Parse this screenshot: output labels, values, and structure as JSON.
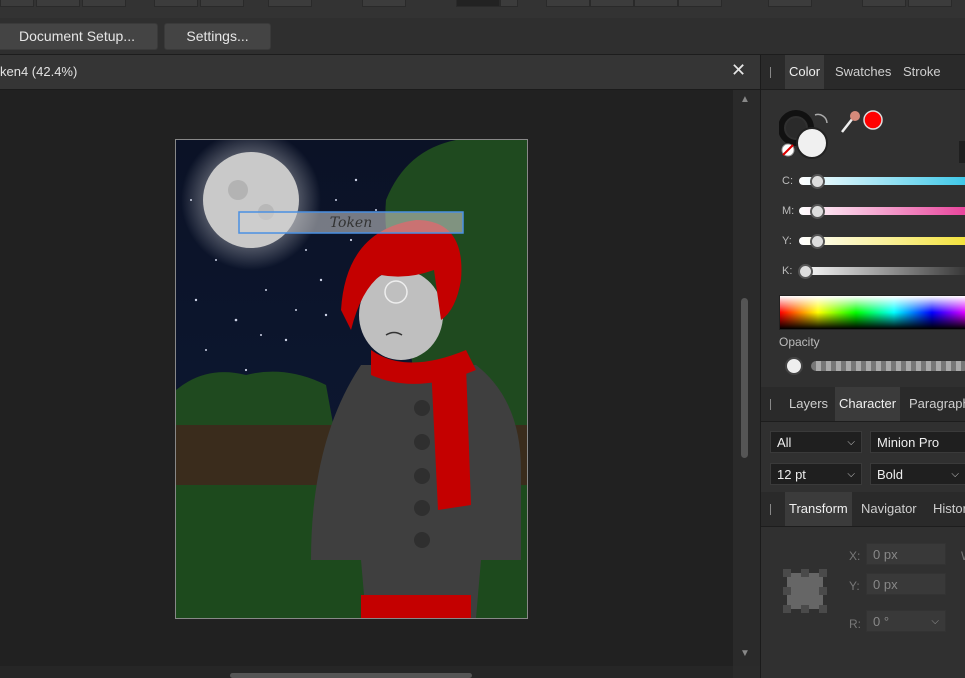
{
  "toolbar": {
    "document_setup_label": "Document Setup...",
    "settings_label": "Settings..."
  },
  "document": {
    "tab_title": "ken4 (42.4%)",
    "text_frame_content": "Token"
  },
  "color_panel": {
    "tabs": [
      "Color",
      "Swatches",
      "Stroke"
    ],
    "active_tab": "Color",
    "sliders": [
      {
        "label": "C:",
        "value": 0
      },
      {
        "label": "M:",
        "value": 0
      },
      {
        "label": "Y:",
        "value": 0
      },
      {
        "label": "K:",
        "value": 0
      }
    ],
    "opacity_label": "Opacity",
    "fill_color": "#ffffff",
    "picker_color": "#ff0000"
  },
  "character_panel": {
    "tabs": [
      "Layers",
      "Character",
      "Paragraph"
    ],
    "active_tab": "Character",
    "scope_value": "All",
    "font_family_value": "Minion Pro",
    "font_size_value": "12 pt",
    "font_style_value": "Bold"
  },
  "transform_panel": {
    "tabs": [
      "Transform",
      "Navigator",
      "History"
    ],
    "active_tab": "Transform",
    "x_label": "X:",
    "x_value": "0 px",
    "y_label": "Y:",
    "y_value": "0 px",
    "r_label": "R:",
    "r_value": "0 °",
    "w_label": "W"
  },
  "colors": {
    "accent_blue": "#4a90e2",
    "scarf_red": "#c40000"
  }
}
